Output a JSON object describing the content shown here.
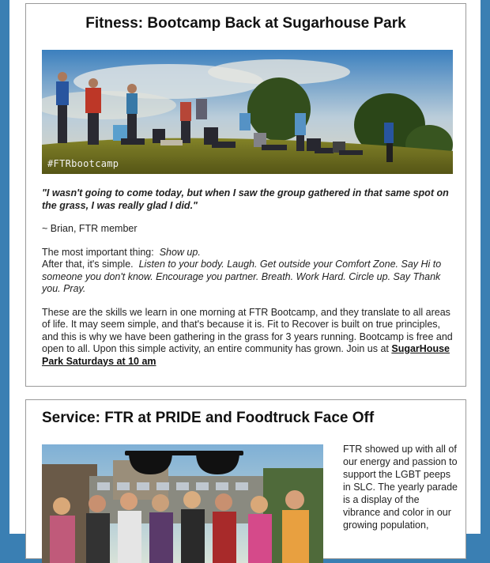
{
  "colors": {
    "frame": "#3a7fb3",
    "card_border": "#9a9a9a"
  },
  "section1": {
    "title": "Fitness:  Bootcamp Back at Sugarhouse Park",
    "photo_tag": "#FTRbootcamp",
    "quote": "\"I wasn't going to come today, but when I saw the group gathered in that same spot on the grass, I was really glad I did.\"",
    "attribution": "~ Brian, FTR member",
    "most_important_label": "The most important thing:",
    "most_important_value": "Show up.",
    "after_label": "After that, it's simple.",
    "after_value": "Listen to your body. Laugh. Get outside your Comfort Zone.  Say Hi to someone you don't know.  Encourage you partner.  Breath.  Work Hard.  Circle up.  Say Thank you.  Pray.",
    "paragraph": "These are the skills we learn in one morning at FTR Bootcamp, and they translate to all areas of life.  It may seem simple, and that's because it is.  Fit to Recover is built on true principles, and this is why we have been gathering in the grass for 3 years running.  Bootcamp is free and open to all.  Upon this simple activity, an entire community has grown.  Join us at",
    "link_text": "SugarHouse Park Saturdays at 10 am"
  },
  "section2": {
    "title": "Service:  FTR at PRIDE and Foodtruck Face Off",
    "side_text": "FTR showed up with all of our energy and passion to support the LGBT peeps in SLC. The yearly parade is a display of the vibrance and color in our growing population,"
  }
}
